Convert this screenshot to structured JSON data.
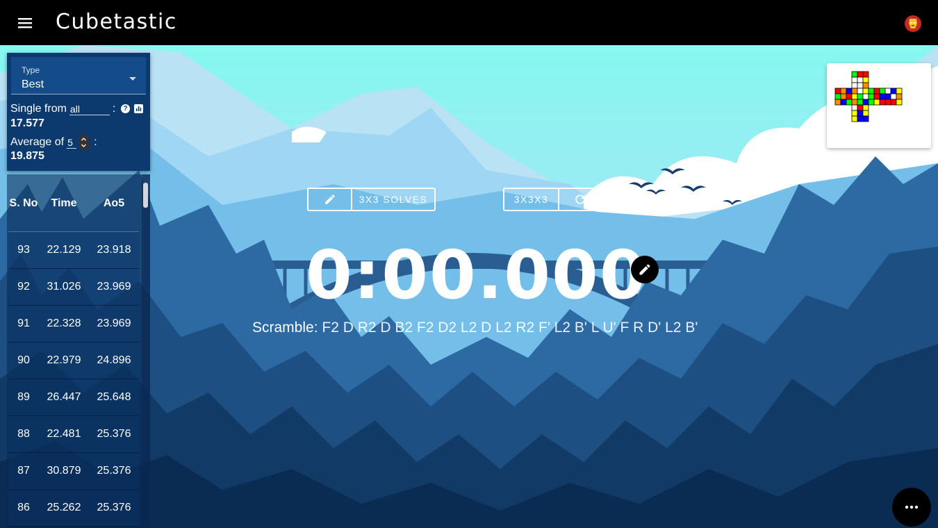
{
  "app": {
    "title": "Cubetastic"
  },
  "stats": {
    "type_label": "Type",
    "type_value": "Best",
    "single_label": "Single from",
    "single_range": "all",
    "colon": ":",
    "help_glyph": "?",
    "single_value": "17.577",
    "average_label": "Average of",
    "average_count": "5",
    "average_value": "19.875"
  },
  "table": {
    "headers": [
      "S. No",
      "Time",
      "Ao5"
    ],
    "rows": [
      [
        "93",
        "22.129",
        "23.918"
      ],
      [
        "92",
        "31.026",
        "23.969"
      ],
      [
        "91",
        "22.328",
        "23.969"
      ],
      [
        "90",
        "22.979",
        "24.896"
      ],
      [
        "89",
        "26.447",
        "25.648"
      ],
      [
        "88",
        "22.481",
        "25.376"
      ],
      [
        "87",
        "30.879",
        "25.376"
      ],
      [
        "86",
        "25.262",
        "25.376"
      ]
    ]
  },
  "session": {
    "label": "3X3 SOLVES"
  },
  "puzzle": {
    "label": "3X3X3"
  },
  "timer": {
    "value": "0:00.000"
  },
  "scramble": {
    "prefix": "Scramble:",
    "moves": "F2 D R2 D B2 F2 D2 L2 D L2 R2 F' L2 B' L U' F R D' L2 B'"
  },
  "cube_net": {
    "U": [
      "G",
      "R",
      "R",
      "W",
      "W",
      "Y",
      "W",
      "W",
      "O"
    ],
    "L": [
      "R",
      "O",
      "B",
      "G",
      "O",
      "R",
      "O",
      "B",
      "G"
    ],
    "F": [
      "O",
      "W",
      "Y",
      "Y",
      "G",
      "W",
      "O",
      "G",
      "B"
    ],
    "R": [
      "G",
      "R",
      "G",
      "G",
      "R",
      "B",
      "G",
      "Y",
      "R"
    ],
    "B": [
      "W",
      "B",
      "Y",
      "B",
      "W",
      "O",
      "R",
      "R",
      "Y"
    ],
    "D": [
      "W",
      "R",
      "Y",
      "Y",
      "B",
      "Y",
      "Y",
      "B",
      "B"
    ]
  },
  "colors": {
    "W": "#ffffff",
    "Y": "#ffff00",
    "R": "#ff0000",
    "O": "#ff8c00",
    "G": "#00ff00",
    "B": "#0000ff"
  },
  "icons": {
    "menu": "menu-icon",
    "avatar": "iron-man-avatar-icon",
    "pencil": "pencil-icon",
    "refresh": "refresh-icon",
    "more": "more-horizontal-icon",
    "help": "help-icon",
    "chart": "bar-chart-icon"
  }
}
